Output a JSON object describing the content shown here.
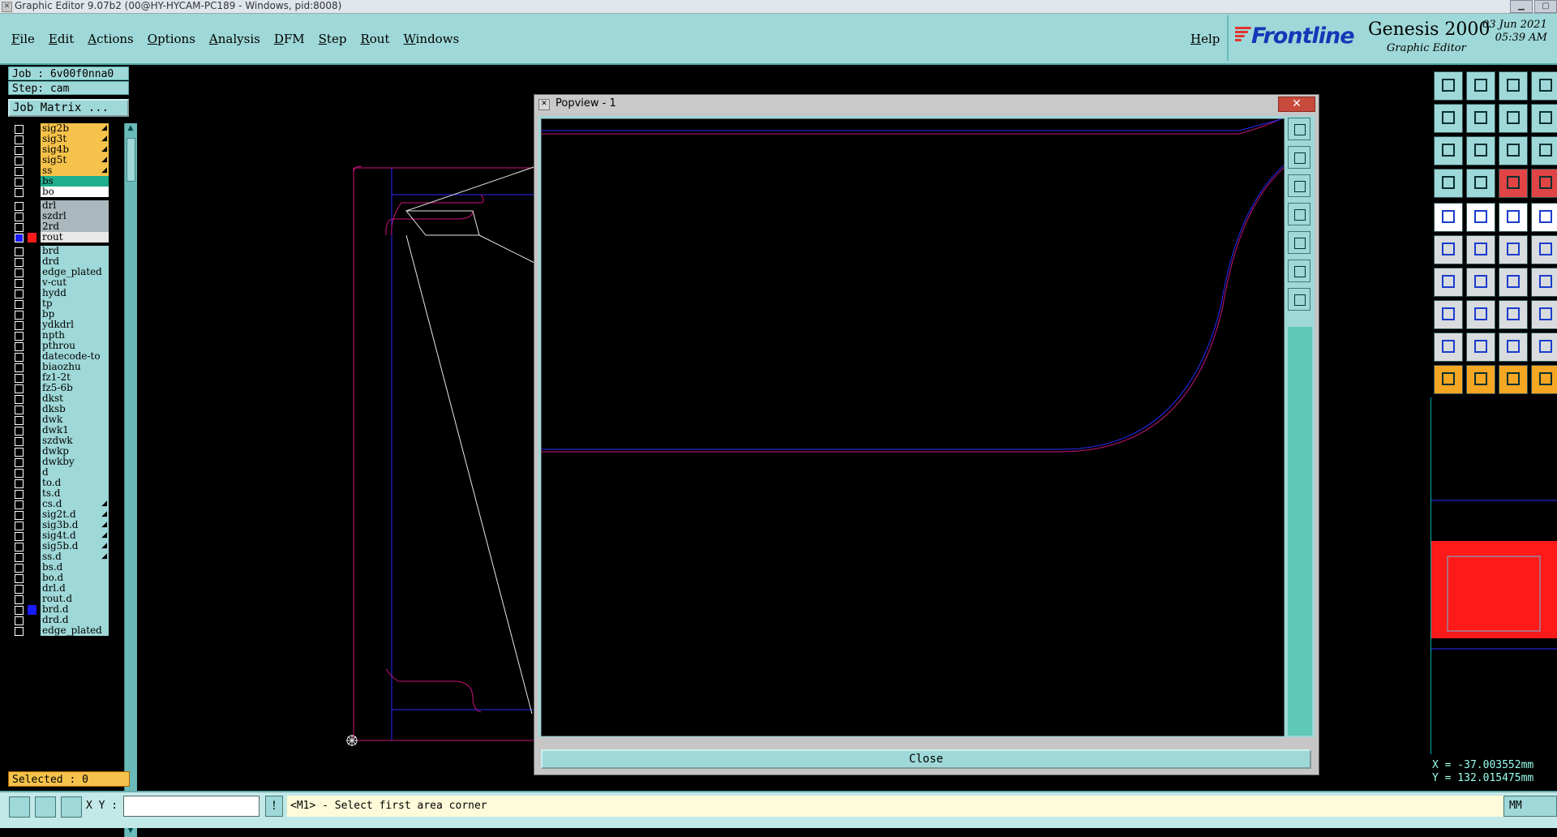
{
  "window": {
    "title": "Graphic Editor 9.07b2 (00@HY-HYCAM-PC189 - Windows, pid:8008)"
  },
  "menu": {
    "items": [
      "File",
      "Edit",
      "Actions",
      "Options",
      "Analysis",
      "DFM",
      "Step",
      "Rout",
      "Windows"
    ],
    "help": "Help"
  },
  "brand": {
    "logo": "Frontline",
    "product": "Genesis 2000",
    "subtitle": "Graphic Editor",
    "date": "03 Jun 2021",
    "time": "05:39 AM"
  },
  "job": {
    "job_label": "Job : 6v00f0nna0",
    "step_label": "Step: cam",
    "matrix_button": "Job Matrix ..."
  },
  "layers": [
    {
      "name": "sig2b",
      "color": "#f5c24b",
      "arrow": true
    },
    {
      "name": "sig3t",
      "color": "#f5c24b",
      "arrow": true
    },
    {
      "name": "sig4b",
      "color": "#f5c24b",
      "arrow": true
    },
    {
      "name": "sig5t",
      "color": "#f5c24b",
      "arrow": true
    },
    {
      "name": "ss",
      "color": "#f5c24b",
      "arrow": true
    },
    {
      "name": "bs",
      "color": "#1fae8c",
      "arrow": false
    },
    {
      "name": "bo",
      "color": "#ffffff",
      "arrow": false
    },
    {
      "name": "drl",
      "color": "#aab8bd",
      "arrow": false,
      "gap": true
    },
    {
      "name": "szdrl",
      "color": "#aab8bd",
      "arrow": false
    },
    {
      "name": "2rd",
      "color": "#aab8bd",
      "arrow": false
    },
    {
      "name": "rout",
      "color": "#e8e8e8",
      "arrow": false,
      "swatch": "#ff1a1a",
      "checked": true
    },
    {
      "name": "brd",
      "color": "#9fd8d8",
      "arrow": false,
      "gap": true
    },
    {
      "name": "drd",
      "color": "#9fd8d8",
      "arrow": false
    },
    {
      "name": "edge_plated",
      "color": "#9fd8d8",
      "arrow": false
    },
    {
      "name": "v-cut",
      "color": "#9fd8d8",
      "arrow": false
    },
    {
      "name": "hydd",
      "color": "#9fd8d8",
      "arrow": false
    },
    {
      "name": "tp",
      "color": "#9fd8d8",
      "arrow": false
    },
    {
      "name": "bp",
      "color": "#9fd8d8",
      "arrow": false
    },
    {
      "name": "ydkdrl",
      "color": "#9fd8d8",
      "arrow": false
    },
    {
      "name": "npth",
      "color": "#9fd8d8",
      "arrow": false
    },
    {
      "name": "pthrou",
      "color": "#9fd8d8",
      "arrow": false
    },
    {
      "name": "datecode-to",
      "color": "#9fd8d8",
      "arrow": false
    },
    {
      "name": "biaozhu",
      "color": "#9fd8d8",
      "arrow": false
    },
    {
      "name": "fz1-2t",
      "color": "#9fd8d8",
      "arrow": false
    },
    {
      "name": "fz5-6b",
      "color": "#9fd8d8",
      "arrow": false
    },
    {
      "name": "dkst",
      "color": "#9fd8d8",
      "arrow": false
    },
    {
      "name": "dksb",
      "color": "#9fd8d8",
      "arrow": false
    },
    {
      "name": "dwk",
      "color": "#9fd8d8",
      "arrow": false
    },
    {
      "name": "dwk1",
      "color": "#9fd8d8",
      "arrow": false
    },
    {
      "name": "szdwk",
      "color": "#9fd8d8",
      "arrow": false
    },
    {
      "name": "dwkp",
      "color": "#9fd8d8",
      "arrow": false
    },
    {
      "name": "dwkby",
      "color": "#9fd8d8",
      "arrow": false
    },
    {
      "name": "d",
      "color": "#9fd8d8",
      "arrow": false
    },
    {
      "name": "to.d",
      "color": "#9fd8d8",
      "arrow": false
    },
    {
      "name": "ts.d",
      "color": "#9fd8d8",
      "arrow": false
    },
    {
      "name": "cs.d",
      "color": "#9fd8d8",
      "arrow": true
    },
    {
      "name": "sig2t.d",
      "color": "#9fd8d8",
      "arrow": true
    },
    {
      "name": "sig3b.d",
      "color": "#9fd8d8",
      "arrow": true
    },
    {
      "name": "sig4t.d",
      "color": "#9fd8d8",
      "arrow": true
    },
    {
      "name": "sig5b.d",
      "color": "#9fd8d8",
      "arrow": true
    },
    {
      "name": "ss.d",
      "color": "#9fd8d8",
      "arrow": true
    },
    {
      "name": "bs.d",
      "color": "#9fd8d8",
      "arrow": false
    },
    {
      "name": "bo.d",
      "color": "#9fd8d8",
      "arrow": false
    },
    {
      "name": "drl.d",
      "color": "#9fd8d8",
      "arrow": false
    },
    {
      "name": "rout.d",
      "color": "#9fd8d8",
      "arrow": false
    },
    {
      "name": "brd.d",
      "color": "#9fd8d8",
      "arrow": false,
      "swatch": "#1a1aff"
    },
    {
      "name": "drd.d",
      "color": "#9fd8d8",
      "arrow": false
    },
    {
      "name": "edge_plated",
      "color": "#9fd8d8",
      "arrow": false
    }
  ],
  "selected_label": "Selected : 0",
  "popview": {
    "title": "Popview - 1",
    "close_x": "✕",
    "close_button": "Close"
  },
  "status": {
    "xy_label": "X Y :",
    "input_value": "",
    "bang": "!",
    "message": "<M1> - Select first area corner",
    "units": "MM"
  },
  "coords": {
    "x": "X = -37.003552mm",
    "y": "Y = 132.015475mm"
  },
  "colors": {
    "panel": "#9fd8d8",
    "outline": "#c8147a",
    "profile": "#2a2aff",
    "highlight": "#f5c24b"
  }
}
